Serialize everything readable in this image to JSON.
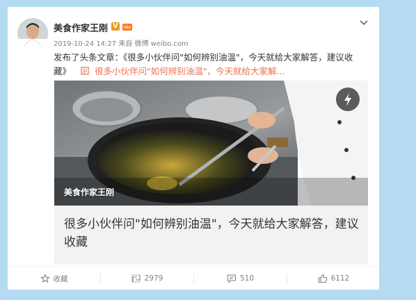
{
  "post": {
    "author": "美食作家王刚",
    "verified_badge": "V",
    "timestamp": "2019-10-24 14:27",
    "source_prefix": "来自",
    "source": "微博 weibo.com",
    "text": "发布了头条文章：《很多小伙伴问\"如何辨别油温\"，今天就给大家解答，建议收藏》",
    "link_text": "很多小伙伴问\"如何辨别油温\"，今天就给大家解..."
  },
  "media": {
    "image_label": "美食作家王刚",
    "title": "很多小伙伴问\"如何辨别油温\"，今天就给大家解答，建议收藏"
  },
  "actions": {
    "favorite": "收藏",
    "repost": "2979",
    "comment": "510",
    "like": "6112"
  },
  "colors": {
    "background": "#b4dbf2",
    "link": "#eb7350",
    "badge": "#f09a1b"
  }
}
